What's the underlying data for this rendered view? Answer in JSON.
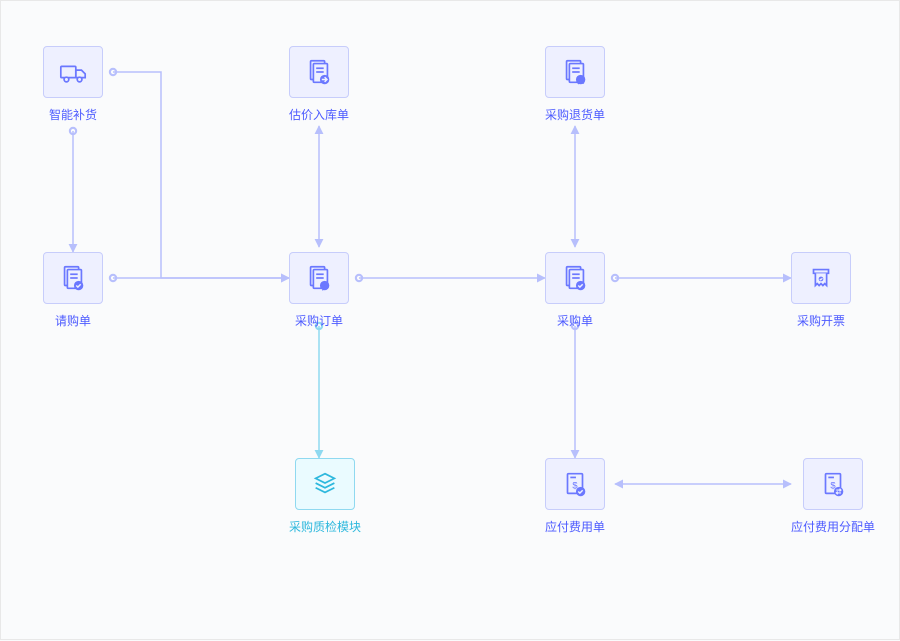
{
  "nodes": {
    "smart_replenish": {
      "label": "智能补货",
      "icon": "truck"
    },
    "purchase_request": {
      "label": "请购单",
      "icon": "doc-check"
    },
    "valuation_inbound": {
      "label": "估价入库单",
      "icon": "doc-arrow"
    },
    "purchase_order": {
      "label": "采购订单",
      "icon": "doc-tag"
    },
    "purchase_return": {
      "label": "采购退货单",
      "icon": "doc-return"
    },
    "purchase_doc": {
      "label": "采购单",
      "icon": "doc-check"
    },
    "purchase_invoice": {
      "label": "采购开票",
      "icon": "invoice"
    },
    "qc_module": {
      "label": "采购质检模块",
      "icon": "stack",
      "highlight": true
    },
    "payable": {
      "label": "应付费用单",
      "icon": "doc-money"
    },
    "payable_alloc": {
      "label": "应付费用分配单",
      "icon": "doc-money-swap"
    }
  },
  "colors": {
    "primary": "#6b78ff",
    "highlight": "#2eb8dd",
    "line": "#b7bffc"
  }
}
